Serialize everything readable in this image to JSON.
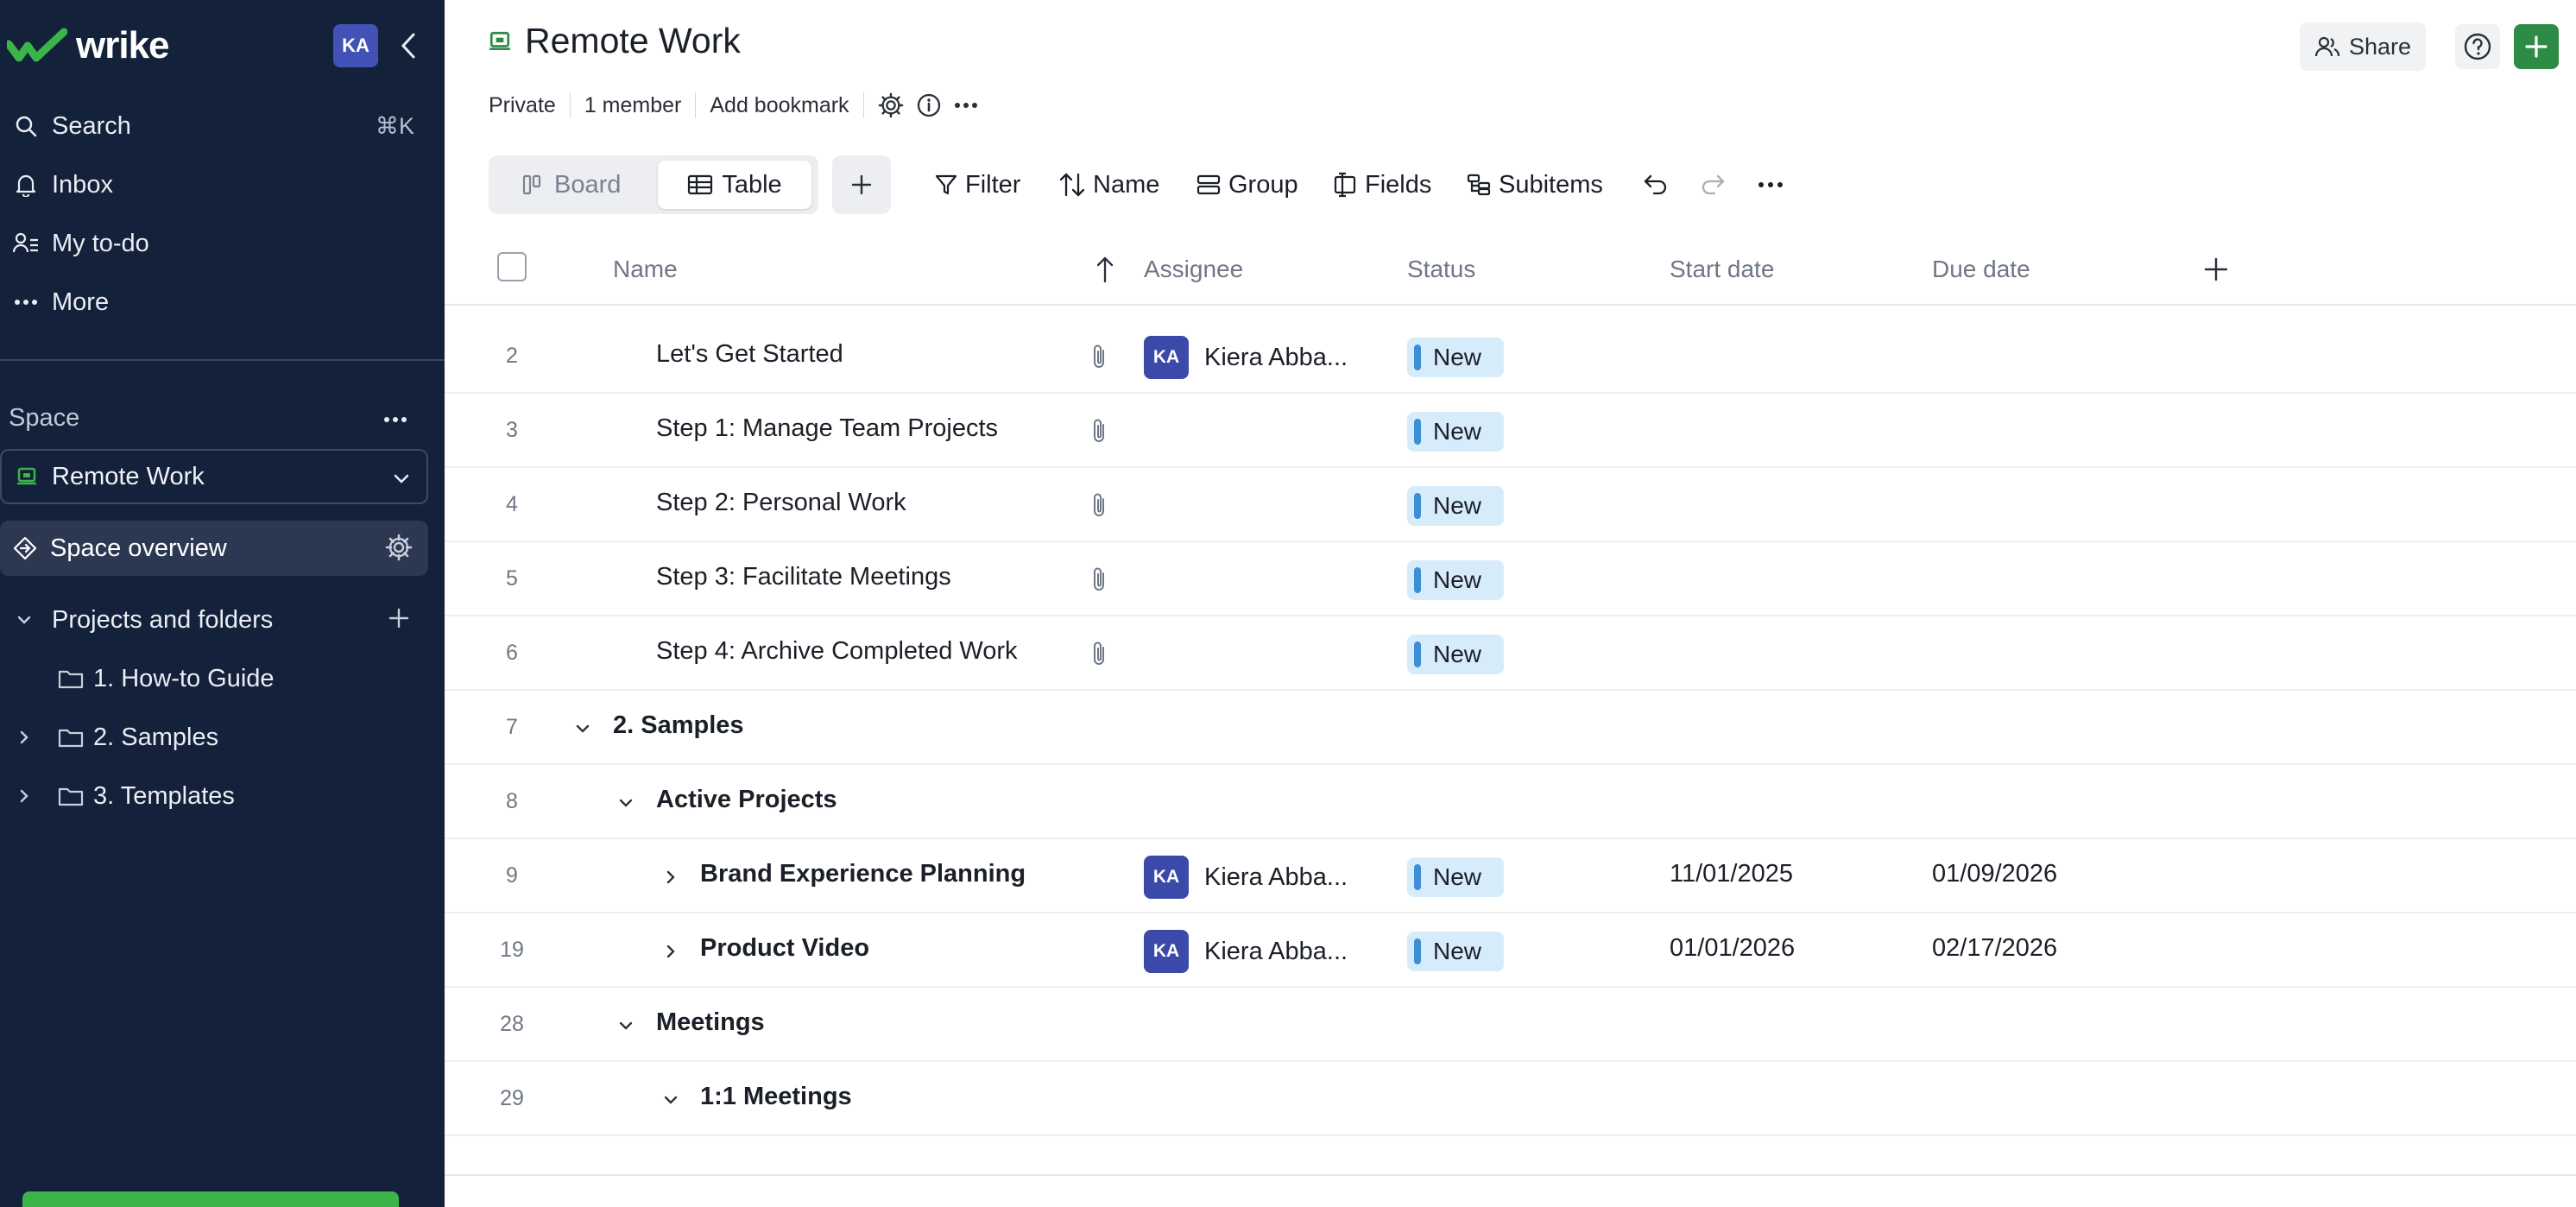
{
  "sidebar": {
    "logo_text": "wrike",
    "user_initials": "KA",
    "nav": [
      {
        "label": "Search",
        "shortcut": "⌘K",
        "icon": "search-icon"
      },
      {
        "label": "Inbox",
        "icon": "bell-icon"
      },
      {
        "label": "My to-do",
        "icon": "person-list-icon"
      },
      {
        "label": "More",
        "icon": "dots-icon"
      }
    ],
    "space_label": "Space",
    "space_name": "Remote Work",
    "overview_label": "Space overview",
    "tree": [
      {
        "label": "Projects and folders",
        "expanded": true
      },
      {
        "label": "1. How-to Guide"
      },
      {
        "label": "2. Samples",
        "expanded": false
      },
      {
        "label": "3. Templates",
        "expanded": false
      }
    ]
  },
  "header": {
    "title": "Remote Work",
    "share_label": "Share",
    "meta": {
      "privacy": "Private",
      "members": "1 member",
      "bookmark": "Add bookmark"
    }
  },
  "toolbar": {
    "board_label": "Board",
    "table_label": "Table",
    "filter_label": "Filter",
    "sort_label": "Name",
    "group_label": "Group",
    "fields_label": "Fields",
    "subitems_label": "Subitems"
  },
  "table": {
    "columns": {
      "name": "Name",
      "assignee": "Assignee",
      "status": "Status",
      "start": "Start date",
      "due": "Due date"
    },
    "rows": [
      {
        "num": "2",
        "name": "Let's Get Started",
        "assignee": "Kiera Abba...",
        "assignee_initials": "KA",
        "status": "New",
        "start": "",
        "due": ""
      },
      {
        "num": "3",
        "name": "Step 1: Manage Team Projects",
        "assignee": "",
        "status": "New",
        "start": "",
        "due": ""
      },
      {
        "num": "4",
        "name": "Step 2: Personal Work",
        "assignee": "",
        "status": "New",
        "start": "",
        "due": ""
      },
      {
        "num": "5",
        "name": "Step 3: Facilitate Meetings",
        "assignee": "",
        "status": "New",
        "start": "",
        "due": ""
      },
      {
        "num": "6",
        "name": "Step 4: Archive Completed Work",
        "assignee": "",
        "status": "New",
        "start": "",
        "due": ""
      },
      {
        "num": "7",
        "name": "2. Samples"
      },
      {
        "num": "8",
        "name": "Active Projects"
      },
      {
        "num": "9",
        "name": "Brand Experience Planning",
        "assignee": "Kiera Abba...",
        "assignee_initials": "KA",
        "status": "New",
        "start": "11/01/2025",
        "due": "01/09/2026"
      },
      {
        "num": "19",
        "name": "Product Video",
        "assignee": "Kiera Abba...",
        "assignee_initials": "KA",
        "status": "New",
        "start": "01/01/2026",
        "due": "02/17/2026"
      },
      {
        "num": "28",
        "name": "Meetings"
      },
      {
        "num": "29",
        "name": "1:1 Meetings"
      }
    ]
  },
  "colors": {
    "sidebar_bg": "#14213a",
    "status_bg": "#d7ecfb",
    "status_bar": "#3c8fd6",
    "avatar": "#3b4aa8",
    "brand_green": "#2e8b46"
  }
}
